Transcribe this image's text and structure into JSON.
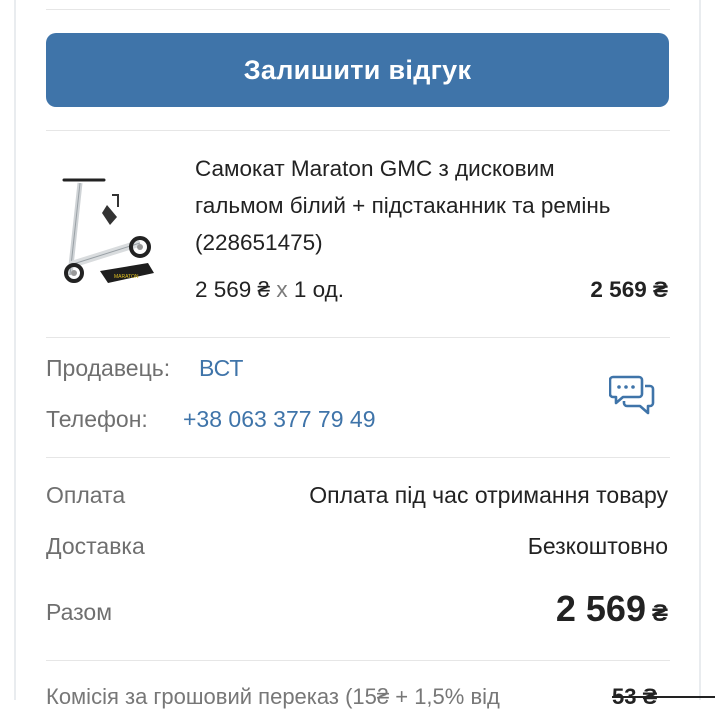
{
  "review_button": {
    "label": "Залишити відгук"
  },
  "product": {
    "title": "Самокат Maraton GMC з дисковим гальмом білий + підстаканник та ремінь (228651475)",
    "unit_price": "2 569 ₴",
    "times": "х",
    "quantity": "1 од.",
    "total": "2 569 ₴"
  },
  "seller": {
    "label": "Продавець:",
    "name": "ВСТ",
    "phone_label": "Телефон:",
    "phone": "+38 063 377 79 49",
    "chat_icon": "chat-bubbles-icon"
  },
  "summary": {
    "payment_label": "Оплата",
    "payment_value": "Оплата під час отримання товару",
    "delivery_label": "Доставка",
    "delivery_value": "Безкоштовно",
    "total_label": "Разом",
    "total_value": "2 569",
    "total_currency": "₴"
  },
  "commission": {
    "text": "Комісія за грошовий переказ (15₴ + 1,5% від",
    "amount": "53 ₴"
  },
  "colors": {
    "accent": "#3f74a9",
    "text": "#222222",
    "muted": "#6f6f6f"
  }
}
